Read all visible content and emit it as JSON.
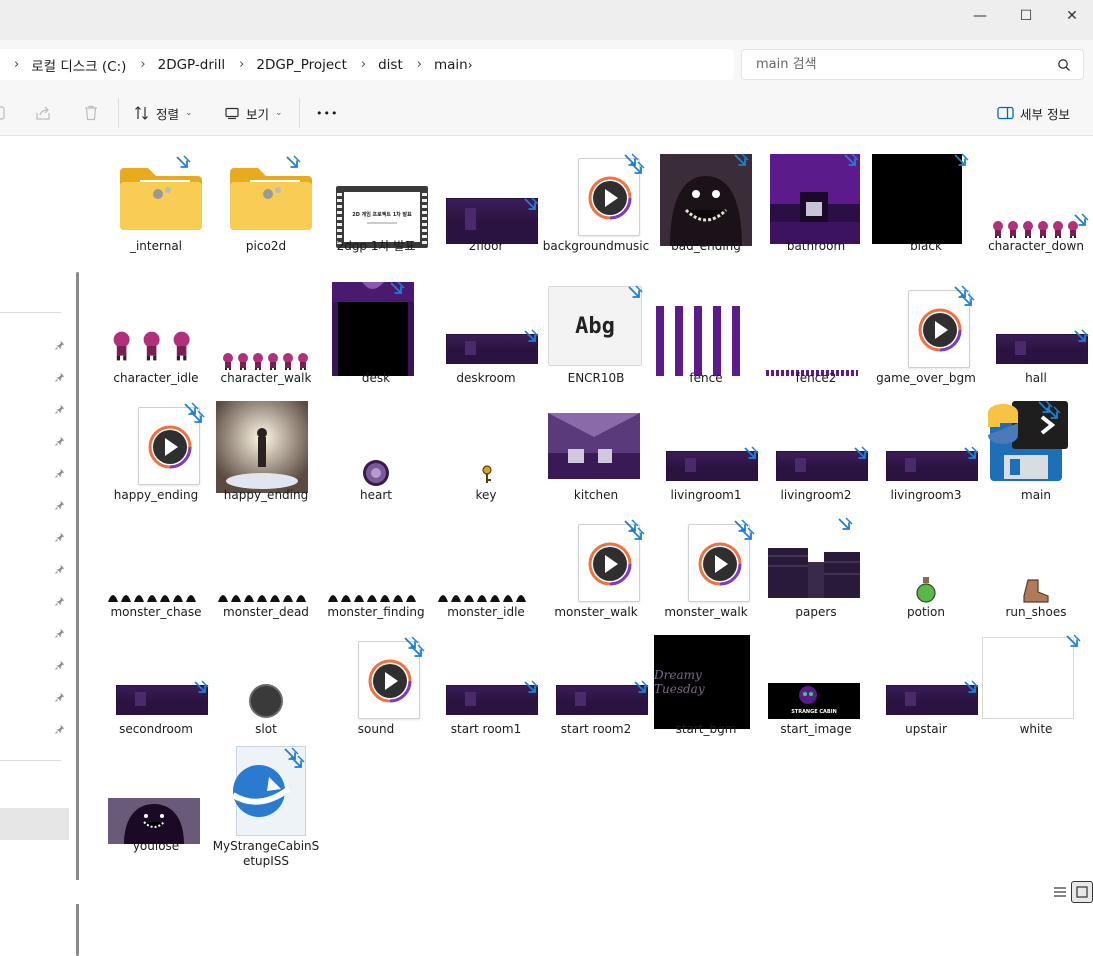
{
  "window": {
    "controls": {
      "minimize": "—",
      "maximize": "☐",
      "close": "✕"
    }
  },
  "address": {
    "crumbs": [
      "로컬 디스크 (C:)",
      "2DGP-drill",
      "2DGP_Project",
      "dist",
      "main"
    ]
  },
  "search": {
    "placeholder": "main 검색"
  },
  "toolbar": {
    "sort_label": "정렬",
    "view_label": "보기",
    "more_label": "•••",
    "details_label": "세부 정보"
  },
  "files": [
    {
      "name": "_internal",
      "type": "folder"
    },
    {
      "name": "pico2d",
      "type": "folder"
    },
    {
      "name": "2dgp 1차 발표",
      "type": "video"
    },
    {
      "name": "2floor",
      "type": "wide-dark"
    },
    {
      "name": "backgroundmusic",
      "type": "media"
    },
    {
      "name": "bad_ending",
      "type": "monster-art"
    },
    {
      "name": "bathroom",
      "type": "room-purple"
    },
    {
      "name": "black",
      "type": "black"
    },
    {
      "name": "character_down",
      "type": "sprite-row"
    },
    {
      "name": "character_idle",
      "type": "sprite-row3"
    },
    {
      "name": "character_walk",
      "type": "sprite-row"
    },
    {
      "name": "desk",
      "type": "desk"
    },
    {
      "name": "deskroom",
      "type": "wide-dark"
    },
    {
      "name": "ENCR10B",
      "type": "font"
    },
    {
      "name": "fence",
      "type": "fence"
    },
    {
      "name": "fence2",
      "type": "thin-bar"
    },
    {
      "name": "game_over_bgm",
      "type": "media"
    },
    {
      "name": "hall",
      "type": "wide-dark"
    },
    {
      "name": "happy_ending",
      "type": "media"
    },
    {
      "name": "happy_ending",
      "type": "happy-art"
    },
    {
      "name": "heart",
      "type": "small-orb"
    },
    {
      "name": "key",
      "type": "small-key"
    },
    {
      "name": "kitchen",
      "type": "kitchen"
    },
    {
      "name": "livingroom1",
      "type": "wide-dark"
    },
    {
      "name": "livingroom2",
      "type": "wide-dark"
    },
    {
      "name": "livingroom3",
      "type": "wide-dark"
    },
    {
      "name": "main",
      "type": "python"
    },
    {
      "name": "monster_chase",
      "type": "black-sprites"
    },
    {
      "name": "monster_dead",
      "type": "black-sprites"
    },
    {
      "name": "monster_finding",
      "type": "black-sprites"
    },
    {
      "name": "monster_idle",
      "type": "black-sprites"
    },
    {
      "name": "monster_walk",
      "type": "media"
    },
    {
      "name": "monster_walk",
      "type": "media"
    },
    {
      "name": "papers",
      "type": "papers"
    },
    {
      "name": "potion",
      "type": "small-potion"
    },
    {
      "name": "run_shoes",
      "type": "small-shoe"
    },
    {
      "name": "secondroom",
      "type": "wide-dark"
    },
    {
      "name": "slot",
      "type": "slot"
    },
    {
      "name": "sound",
      "type": "media"
    },
    {
      "name": "start room1",
      "type": "wide-dark"
    },
    {
      "name": "start room2",
      "type": "wide-dark"
    },
    {
      "name": "start_bgm",
      "type": "dreamy"
    },
    {
      "name": "start_image",
      "type": "start-image"
    },
    {
      "name": "upstair",
      "type": "wide-dark"
    },
    {
      "name": "white",
      "type": "white"
    },
    {
      "name": "youlose",
      "type": "youlose"
    },
    {
      "name": "MyStrangeCabinSetupISS",
      "type": "setup"
    }
  ],
  "thumb_labels": {
    "video_line1": "2D 게임 프로젝트 1차 발표",
    "font_sample": "Abg",
    "dreamy_text": "Dreamy Tuesday",
    "start_image_text": "STRANGE CABIN"
  },
  "colors": {
    "accent": "#0067c0",
    "shortcut": "#1e7fd6",
    "purple": "#5b1b8a",
    "folder": "#f6c343"
  }
}
